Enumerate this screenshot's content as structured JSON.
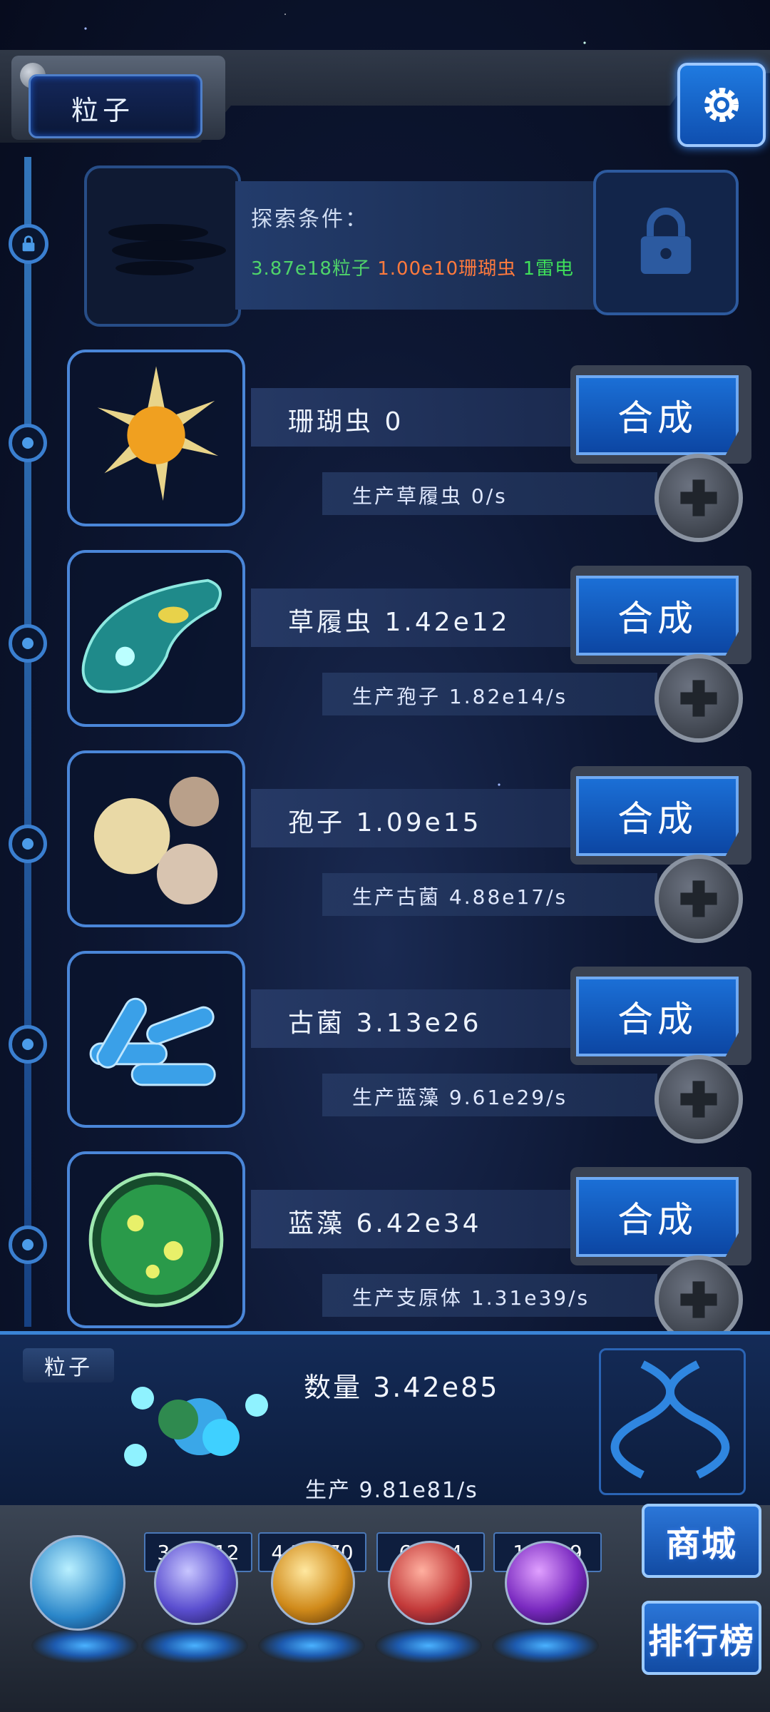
{
  "header": {
    "title": "粒子"
  },
  "explore": {
    "label": "探索条件：",
    "req_particles": "3.87e18粒子",
    "req_coral": "1.00e10珊瑚虫",
    "req_thunder": "1雷电"
  },
  "items": [
    {
      "name": "珊瑚虫",
      "count": "0",
      "produce": "生产草履虫",
      "rate": "0/s",
      "action": "合成"
    },
    {
      "name": "草履虫",
      "count": "1.42e12",
      "produce": "生产孢子",
      "rate": "1.82e14/s",
      "action": "合成"
    },
    {
      "name": "孢子",
      "count": "1.09e15",
      "produce": "生产古菌",
      "rate": "4.88e17/s",
      "action": "合成"
    },
    {
      "name": "古菌",
      "count": "3.13e26",
      "produce": "生产蓝藻",
      "rate": "9.61e29/s",
      "action": "合成"
    },
    {
      "name": "蓝藻",
      "count": "6.42e34",
      "produce": "生产支原体",
      "rate": "1.31e39/s",
      "action": "合成"
    }
  ],
  "stats": {
    "tag": "粒子",
    "count_label": "数量",
    "count": "3.42e85",
    "prod_label": "生产",
    "prod": "9.81e81/s"
  },
  "resources": [
    "3.95e12",
    "4.30e70",
    "61794",
    "1.29e9"
  ],
  "buttons": {
    "shop": "商城",
    "rank": "排行榜"
  },
  "colors": {
    "req_particles": "#4fd36a",
    "req_coral": "#ff7a3d",
    "req_thunder": "#3fdf5a"
  }
}
